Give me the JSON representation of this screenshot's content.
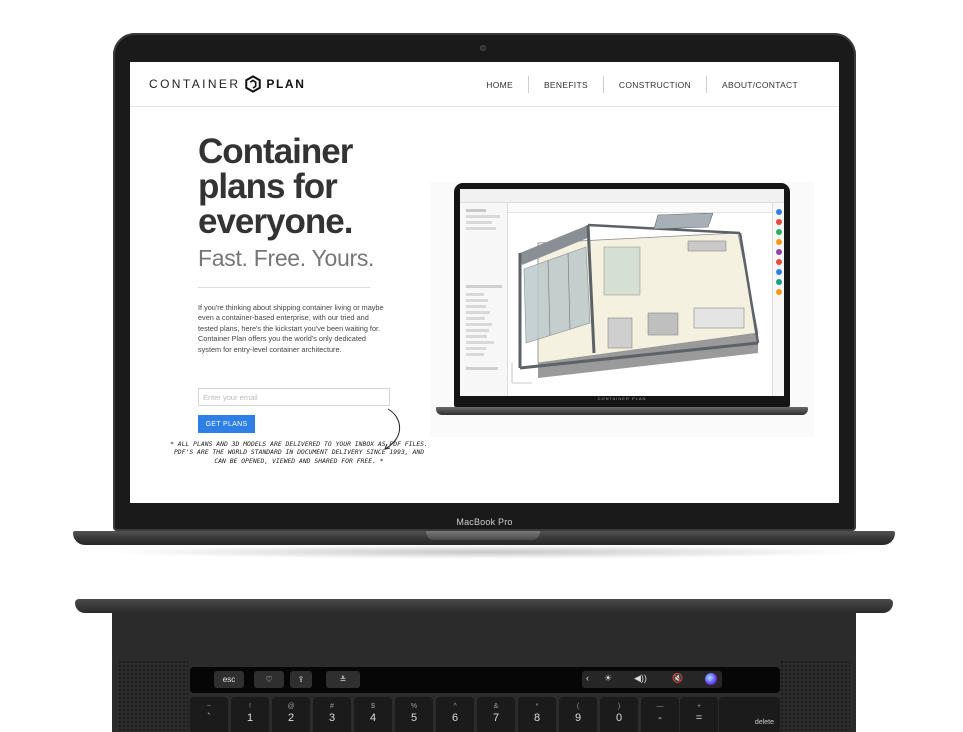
{
  "device": {
    "model_label": "MacBook Pro"
  },
  "header": {
    "logo_word1": "CONTAINER",
    "logo_word2": "PLAN",
    "nav": [
      {
        "label": "HOME"
      },
      {
        "label": "BENEFITS"
      },
      {
        "label": "CONSTRUCTION"
      },
      {
        "label": "ABOUT/CONTACT"
      }
    ]
  },
  "hero": {
    "title_lines": [
      "Container",
      "plans for",
      "everyone."
    ],
    "subtitle": "Fast. Free. Yours.",
    "body": "If you're thinking about shipping container living or maybe even a container-based enterprise, with our tried and tested plans, here's the kickstart you've been waiting for. Container Plan offers you the world's only dedicated system for entry-level container architecture.",
    "email_placeholder": "Enter your email",
    "cta_label": "GET PLANS",
    "note": "* ALL PLANS AND 3D MODELS ARE DELIVERED TO YOUR INBOX AS PDF FILES. PDF'S ARE THE WORLD STANDARD IN DOCUMENT DELIVERY SINCE 1993, AND CAN BE OPENED, VIEWED AND SHARED FOR FREE. *"
  },
  "mockup": {
    "brand_text": "CONTAINER PLAN"
  },
  "touchbar": {
    "keys": [
      {
        "label": "esc",
        "icon": "esc-key"
      },
      {
        "label": "♡",
        "icon": "heart-icon"
      },
      {
        "label": "⇪",
        "icon": "share-icon"
      },
      {
        "label": "≚",
        "icon": "sliders-icon"
      }
    ],
    "controls": [
      "‹",
      "☀",
      "◀))",
      "🔇"
    ]
  },
  "keyboard": {
    "keys": [
      {
        "sym": "~",
        "num": "`"
      },
      {
        "sym": "!",
        "num": "1"
      },
      {
        "sym": "@",
        "num": "2"
      },
      {
        "sym": "#",
        "num": "3"
      },
      {
        "sym": "$",
        "num": "4"
      },
      {
        "sym": "%",
        "num": "5"
      },
      {
        "sym": "^",
        "num": "6"
      },
      {
        "sym": "&",
        "num": "7"
      },
      {
        "sym": "*",
        "num": "8"
      },
      {
        "sym": "(",
        "num": "9"
      },
      {
        "sym": ")",
        "num": "0"
      },
      {
        "sym": "—",
        "num": "-"
      },
      {
        "sym": "+",
        "num": "="
      }
    ],
    "delete_label": "delete"
  },
  "colors": {
    "accent": "#2e7fe6",
    "title": "#333333",
    "subtitle": "#777777"
  }
}
